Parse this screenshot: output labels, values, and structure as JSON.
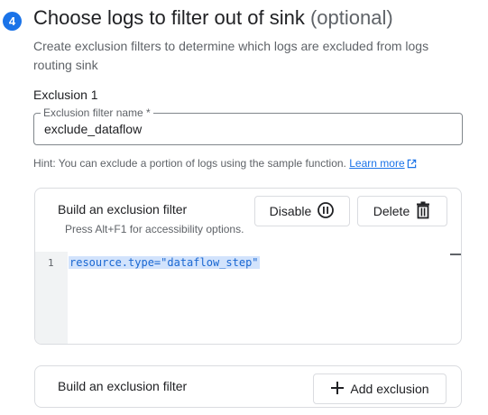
{
  "step": {
    "number": "4",
    "title": "Choose logs to filter out of sink",
    "optional": "(optional)",
    "description": "Create exclusion filters to determine which logs are excluded from logs routing sink"
  },
  "exclusion": {
    "heading": "Exclusion 1",
    "name_label": "Exclusion filter name *",
    "name_value": "exclude_dataflow",
    "hint": "Hint: You can exclude a portion of logs using the sample function.",
    "learn_more": "Learn more"
  },
  "filter_card": {
    "title": "Build an exclusion filter",
    "accessibility": "Press Alt+F1 for accessibility options.",
    "disable_label": "Disable",
    "delete_label": "Delete",
    "line_number": "1",
    "code": "resource.type=\"dataflow_step\""
  },
  "add_card": {
    "title": "Build an exclusion filter",
    "add_label": "Add exclusion"
  },
  "icons": {
    "disable": "pause-circle-icon",
    "delete": "trash-icon",
    "add": "plus-icon",
    "external": "open-in-new-icon"
  },
  "colors": {
    "accent": "#1a73e8",
    "code_highlight": "#d2e3fc",
    "border": "#dadce0"
  }
}
